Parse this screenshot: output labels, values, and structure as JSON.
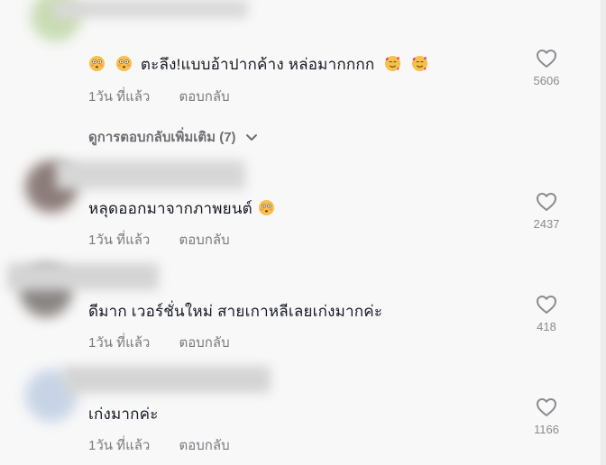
{
  "comments": [
    {
      "text_prefix": "",
      "text": "ตะลึง!แบบอ้าปากค้าง หล่อมากกกก",
      "time": "1วัน ที่แล้ว",
      "reply": "ตอบกลับ",
      "likes": "5606",
      "leading_emojis": [
        "flushed-face",
        "flushed-face"
      ],
      "trailing_emojis": [
        "smiling-face-with-hearts",
        "smiling-face-with-hearts"
      ]
    },
    {
      "text": "หลุดออกมาจากภาพยนต์",
      "time": "1วัน ที่แล้ว",
      "reply": "ตอบกลับ",
      "likes": "2437",
      "trailing_emojis": [
        "flushed-face"
      ]
    },
    {
      "text": "ดีมาก เวอร์ชั่นใหม่ สายเกาหลีเลยเก่งมากค่ะ",
      "time": "1วัน ที่แล้ว",
      "reply": "ตอบกลับ",
      "likes": "418"
    },
    {
      "text": "เก่งมากค่ะ",
      "time": "1วัน ที่แล้ว",
      "reply": "ตอบกลับ",
      "likes": "1166"
    }
  ],
  "view_more_replies": "ดูการตอบกลับเพิ่มเติม (7)",
  "colors": {
    "background": "#f8f8f8",
    "text": "#161823",
    "muted": "#7a7b80",
    "icon": "#8a8b91"
  }
}
